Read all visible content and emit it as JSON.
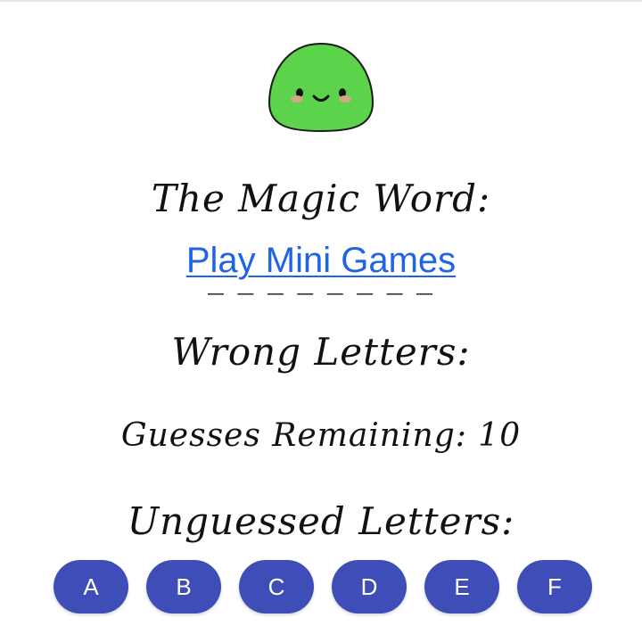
{
  "colors": {
    "link": "#1f63e6",
    "button": "#3f4db8",
    "mascot": "#5bd34a"
  },
  "mascot": {
    "icon": "green-blob-icon"
  },
  "magic_word": {
    "title": "The Magic Word:",
    "link_text": "Play Mini Games",
    "blanks": "_ _ _ _ _ _ _ _"
  },
  "wrong_letters": {
    "title": "Wrong Letters:"
  },
  "guesses": {
    "text": "Guesses Remaining: 10"
  },
  "unguessed": {
    "title": "Unguessed Letters:",
    "letters": [
      "A",
      "B",
      "C",
      "D",
      "E",
      "F"
    ]
  }
}
